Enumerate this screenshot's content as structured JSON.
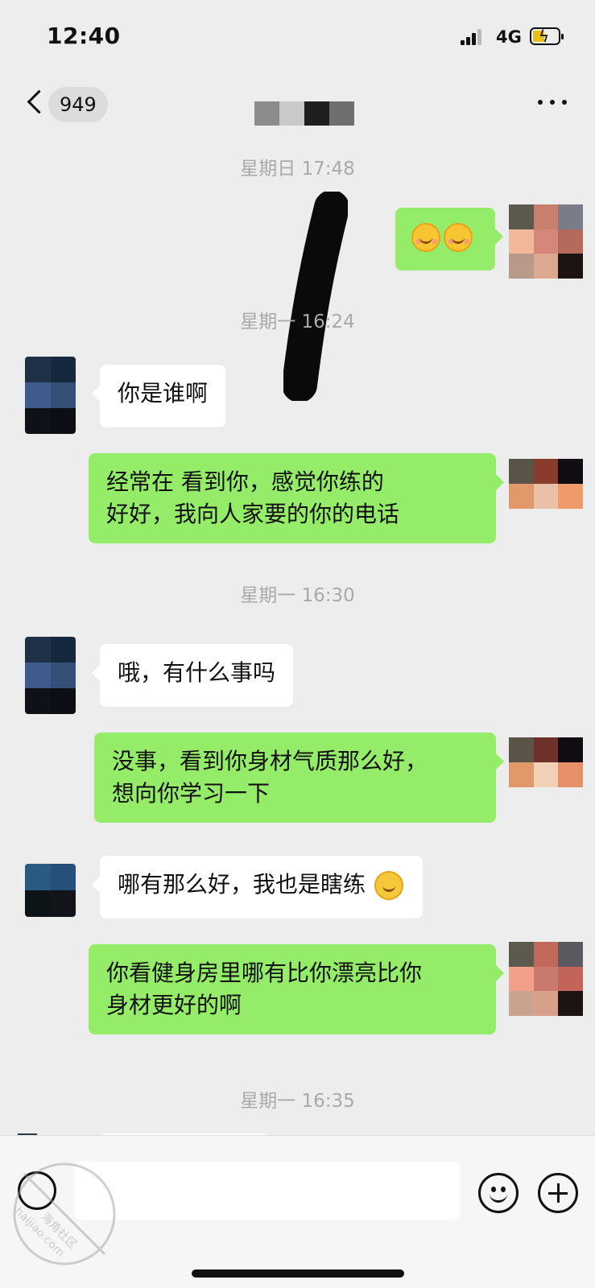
{
  "status_bar": {
    "time": "12:40",
    "network": "4G"
  },
  "nav": {
    "unread_count": "949",
    "title": ""
  },
  "colors": {
    "background": "#ededed",
    "my_bubble": "#95ec69",
    "their_bubble": "#ffffff",
    "time_label": "#a9a9a9"
  },
  "messages": {
    "t1": "星期日 17:48",
    "m1_emoji": [
      "blush-smile-emoji",
      "blush-smile-emoji"
    ],
    "t2": "星期一 16:24",
    "m2": "你是谁啊",
    "m3_line1": "经常在    看到你，感觉你练的",
    "m3_line2": "好好，我向人家要的你的电话",
    "t3": "星期一 16:30",
    "m4": "哦，有什么事吗",
    "m5_line1": "没事，看到你身材气质那么好，",
    "m5_line2": "想向你学习一下",
    "m6": "哪有那么好，我也是瞎练",
    "t4": "星期一 16:35",
    "m7_line1": "你看健身房里哪有比你漂亮比你",
    "m7_line2": "身材更好的啊"
  },
  "input_bar": {
    "placeholder": ""
  },
  "watermark": {
    "line1": "海角社区",
    "line2": "haijiao.com"
  }
}
